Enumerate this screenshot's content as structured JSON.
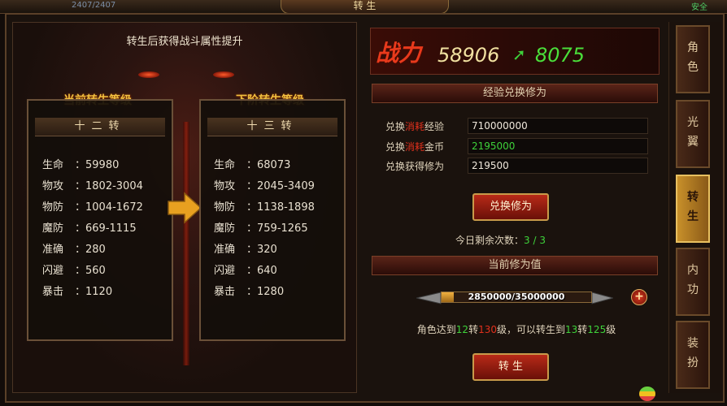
{
  "top": {
    "left_value": "2407/2407",
    "title": "转 生",
    "right_text": "安全"
  },
  "left_panel": {
    "title": "转生后获得战斗属性提升",
    "current": {
      "header": "当前转生等级",
      "tier": "十二转",
      "stats": [
        {
          "k": "生命",
          "v": "59980"
        },
        {
          "k": "物攻",
          "v": "1802-3004"
        },
        {
          "k": "物防",
          "v": "1004-1672"
        },
        {
          "k": "魔防",
          "v": "669-1115"
        },
        {
          "k": "准确",
          "v": "280"
        },
        {
          "k": "闪避",
          "v": "560"
        },
        {
          "k": "暴击",
          "v": "1120"
        }
      ]
    },
    "next": {
      "header": "下阶转生等级",
      "tier": "十三转",
      "stats": [
        {
          "k": "生命",
          "v": "68073"
        },
        {
          "k": "物攻",
          "v": "2045-3409"
        },
        {
          "k": "物防",
          "v": "1138-1898"
        },
        {
          "k": "魔防",
          "v": "759-1265"
        },
        {
          "k": "准确",
          "v": "320"
        },
        {
          "k": "闪避",
          "v": "640"
        },
        {
          "k": "暴击",
          "v": "1280"
        }
      ]
    }
  },
  "power": {
    "label": "战力",
    "current": "58906",
    "next": "8075"
  },
  "exchange": {
    "header": "经验兑换修为",
    "rows": [
      {
        "pre": "兑换",
        "red": "消耗",
        "post": "经验",
        "value": "710000000"
      },
      {
        "pre": "兑换",
        "red": "消耗",
        "post": "金币",
        "value": "2195000"
      },
      {
        "pre": "兑换获得修为",
        "red": "",
        "post": "",
        "value": "219500"
      }
    ],
    "button": "兑换修为",
    "remain_label": "今日剩余次数：",
    "remain_value": "3 / 3"
  },
  "cultivation": {
    "header": "当前修为值",
    "progress_text": "2850000/35000000",
    "progress_fraction": 0.0814,
    "plus": "+",
    "cond": {
      "a": "角色达到",
      "b": "12",
      "c": "转",
      "d": "130",
      "e": "级，可以转生到",
      "f": "13",
      "g": "转",
      "h": "125",
      "i": "级"
    },
    "button": "转 生"
  },
  "tabs": [
    "角色",
    "光翼",
    "转生",
    "内功",
    "装扮"
  ],
  "active_tab": 2
}
